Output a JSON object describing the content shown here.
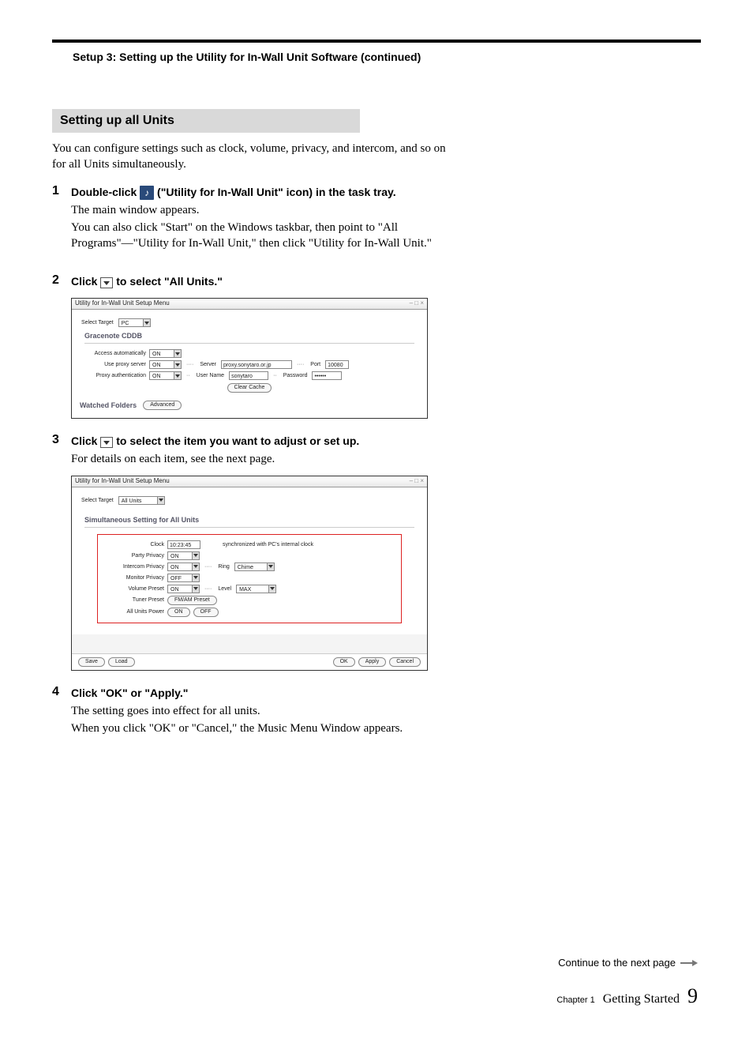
{
  "breadcrumb": "Setup 3: Setting up the Utility for In-Wall Unit Software (continued)",
  "section_title": "Setting up all Units",
  "intro": "You can configure settings such as clock, volume, privacy, and intercom, and so on for all Units simultaneously.",
  "steps": {
    "s1": {
      "num": "1",
      "title_pre": "Double-click ",
      "icon_alt": "♪",
      "title_post": " (\"Utility for In-Wall Unit\" icon) in the task tray.",
      "desc1": "The main window appears.",
      "desc2": "You can also click \"Start\" on the Windows taskbar, then point to \"All Programs\"—\"Utility for In-Wall Unit,\" then click \"Utility for In-Wall Unit.\""
    },
    "s2": {
      "num": "2",
      "title_pre": "Click ",
      "title_post": " to select \"All Units.\""
    },
    "s3": {
      "num": "3",
      "title_pre": "Click ",
      "title_post": " to select the item you want to adjust or set up.",
      "desc": "For details on each item, see the next page."
    },
    "s4": {
      "num": "4",
      "title": "Click \"OK\" or \"Apply.\"",
      "desc1": "The setting goes into effect for all units.",
      "desc2": "When you click \"OK\" or \"Cancel,\" the Music Menu Window appears."
    }
  },
  "mock1": {
    "window_title": "Utility for In-Wall Unit Setup Menu",
    "select_target_label": "Select Target",
    "select_target_value": "PC",
    "section": "Gracenote CDDB",
    "rows": {
      "access_label": "Access automatically",
      "access_val": "ON",
      "proxy_label": "Use proxy server",
      "proxy_val": "ON",
      "server_label": "Server",
      "server_val": "proxy.sonytaro.or.jp",
      "port_label": "Port",
      "port_val": "10080",
      "auth_label": "Proxy authentication",
      "auth_val": "ON",
      "user_label": "User Name",
      "user_val": "sonytaro",
      "pass_label": "Password",
      "pass_val": "••••••"
    },
    "clear_cache": "Clear Cache",
    "watched_folders": "Watched Folders",
    "advanced": "Advanced"
  },
  "mock2": {
    "window_title": "Utility for In-Wall Unit Setup Menu",
    "select_target_label": "Select Target",
    "select_target_value": "All Units",
    "section": "Simultaneous Setting for All Units",
    "rows": {
      "clock_label": "Clock",
      "clock_val": "10:23:45",
      "clock_note": "synchronized with PC's internal clock",
      "party_label": "Party Privacy",
      "party_val": "ON",
      "intercom_label": "Intercom Privacy",
      "intercom_val": "ON",
      "ring_label": "Ring",
      "ring_val": "Chime",
      "monitor_label": "Monitor Privacy",
      "monitor_val": "OFF",
      "volume_label": "Volume Preset",
      "volume_val": "ON",
      "level_label": "Level",
      "level_val": "MAX",
      "tuner_label": "Tuner Preset",
      "tuner_btn": "FM/AM Preset",
      "power_label": "All Units Power",
      "power_on": "ON",
      "power_off": "OFF"
    },
    "footer": {
      "save": "Save",
      "load": "Load",
      "ok": "OK",
      "apply": "Apply",
      "cancel": "Cancel"
    }
  },
  "continue_text": "Continue to the next page",
  "footer": {
    "chapter": "Chapter 1",
    "section": "Getting Started",
    "page": "9"
  }
}
